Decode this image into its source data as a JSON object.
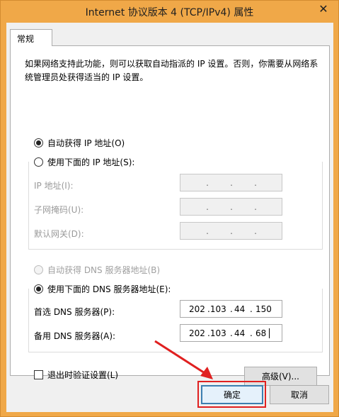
{
  "window": {
    "title": "Internet 协议版本 4 (TCP/IPv4) 属性"
  },
  "tabs": [
    {
      "label": "常规"
    }
  ],
  "description": "如果网络支持此功能，则可以获取自动指派的 IP 设置。否则，你需要从网络系统管理员处获得适当的 IP 设置。",
  "ip": {
    "auto_label": "自动获得 IP 地址(O)",
    "manual_label": "使用下面的 IP 地址(S):",
    "selected": "auto",
    "fields": [
      {
        "label": "IP 地址(I):",
        "value": [
          ".",
          ".",
          "."
        ]
      },
      {
        "label": "子网掩码(U):",
        "value": [
          ".",
          ".",
          "."
        ]
      },
      {
        "label": "默认网关(D):",
        "value": [
          ".",
          ".",
          "."
        ]
      }
    ]
  },
  "dns": {
    "auto_label": "自动获得 DNS 服务器地址(B)",
    "manual_label": "使用下面的 DNS 服务器地址(E):",
    "selected": "manual",
    "preferred_label": "首选 DNS 服务器(P):",
    "preferred": [
      "202",
      ".103",
      ".",
      "44",
      ".",
      "150"
    ],
    "alternate_label": "备用 DNS 服务器(A):",
    "alternate": [
      "202",
      ".103",
      ".",
      "44",
      ".",
      "68"
    ]
  },
  "validate_label": "退出时验证设置(L)",
  "advanced_label": "高级(V)...",
  "ok_label": "确定",
  "cancel_label": "取消",
  "colors": {
    "frame": "#f0a848",
    "highlight": "#e02020",
    "default_button": "#3c7fb1"
  },
  "icons": {
    "close": "close-icon"
  }
}
